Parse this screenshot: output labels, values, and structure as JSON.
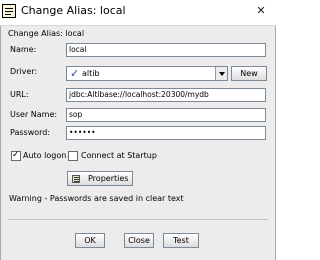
{
  "window": {
    "title": "Change Alias: local",
    "close_glyph": "✕"
  },
  "dialog": {
    "subtitle": "Change Alias: local",
    "name": {
      "label": "Name:",
      "value": "local"
    },
    "driver": {
      "label": "Driver:",
      "value": "altib",
      "new_button": "New",
      "check_icon": "checkmark-icon"
    },
    "url": {
      "label": "URL:",
      "value": "jdbc:Altibase://localhost:20300/mydb"
    },
    "user": {
      "label": "User Name:",
      "value": "sop"
    },
    "password": {
      "label": "Password:",
      "value": "••••••"
    },
    "auto_logon": {
      "label": "Auto logon",
      "checked": true
    },
    "connect_startup": {
      "label": "Connect at Startup",
      "checked": false
    },
    "properties_button": "Properties",
    "warning": "Warning - Passwords are saved in clear text",
    "buttons": {
      "ok": "OK",
      "close": "Close",
      "test": "Test"
    }
  }
}
